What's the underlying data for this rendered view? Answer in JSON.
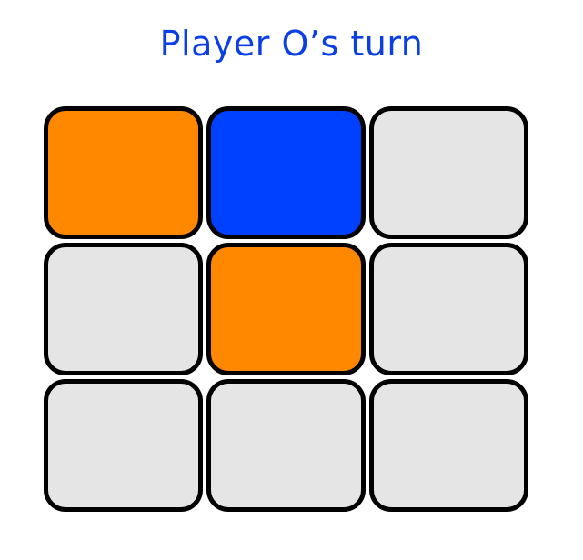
{
  "status": {
    "text": "Player O’s turn",
    "color": "#0b3fe6"
  },
  "board": {
    "empty_color": "#e5e5e5",
    "border_color": "#000000",
    "player_colors": {
      "X": "#ff8800",
      "O": "#0040ff"
    },
    "cells": [
      {
        "owner": "X",
        "color": "#ff8800"
      },
      {
        "owner": "O",
        "color": "#0040ff"
      },
      {
        "owner": "",
        "color": "#e5e5e5"
      },
      {
        "owner": "",
        "color": "#e5e5e5"
      },
      {
        "owner": "X",
        "color": "#ff8800"
      },
      {
        "owner": "",
        "color": "#e5e5e5"
      },
      {
        "owner": "",
        "color": "#e5e5e5"
      },
      {
        "owner": "",
        "color": "#e5e5e5"
      },
      {
        "owner": "",
        "color": "#e5e5e5"
      }
    ]
  }
}
